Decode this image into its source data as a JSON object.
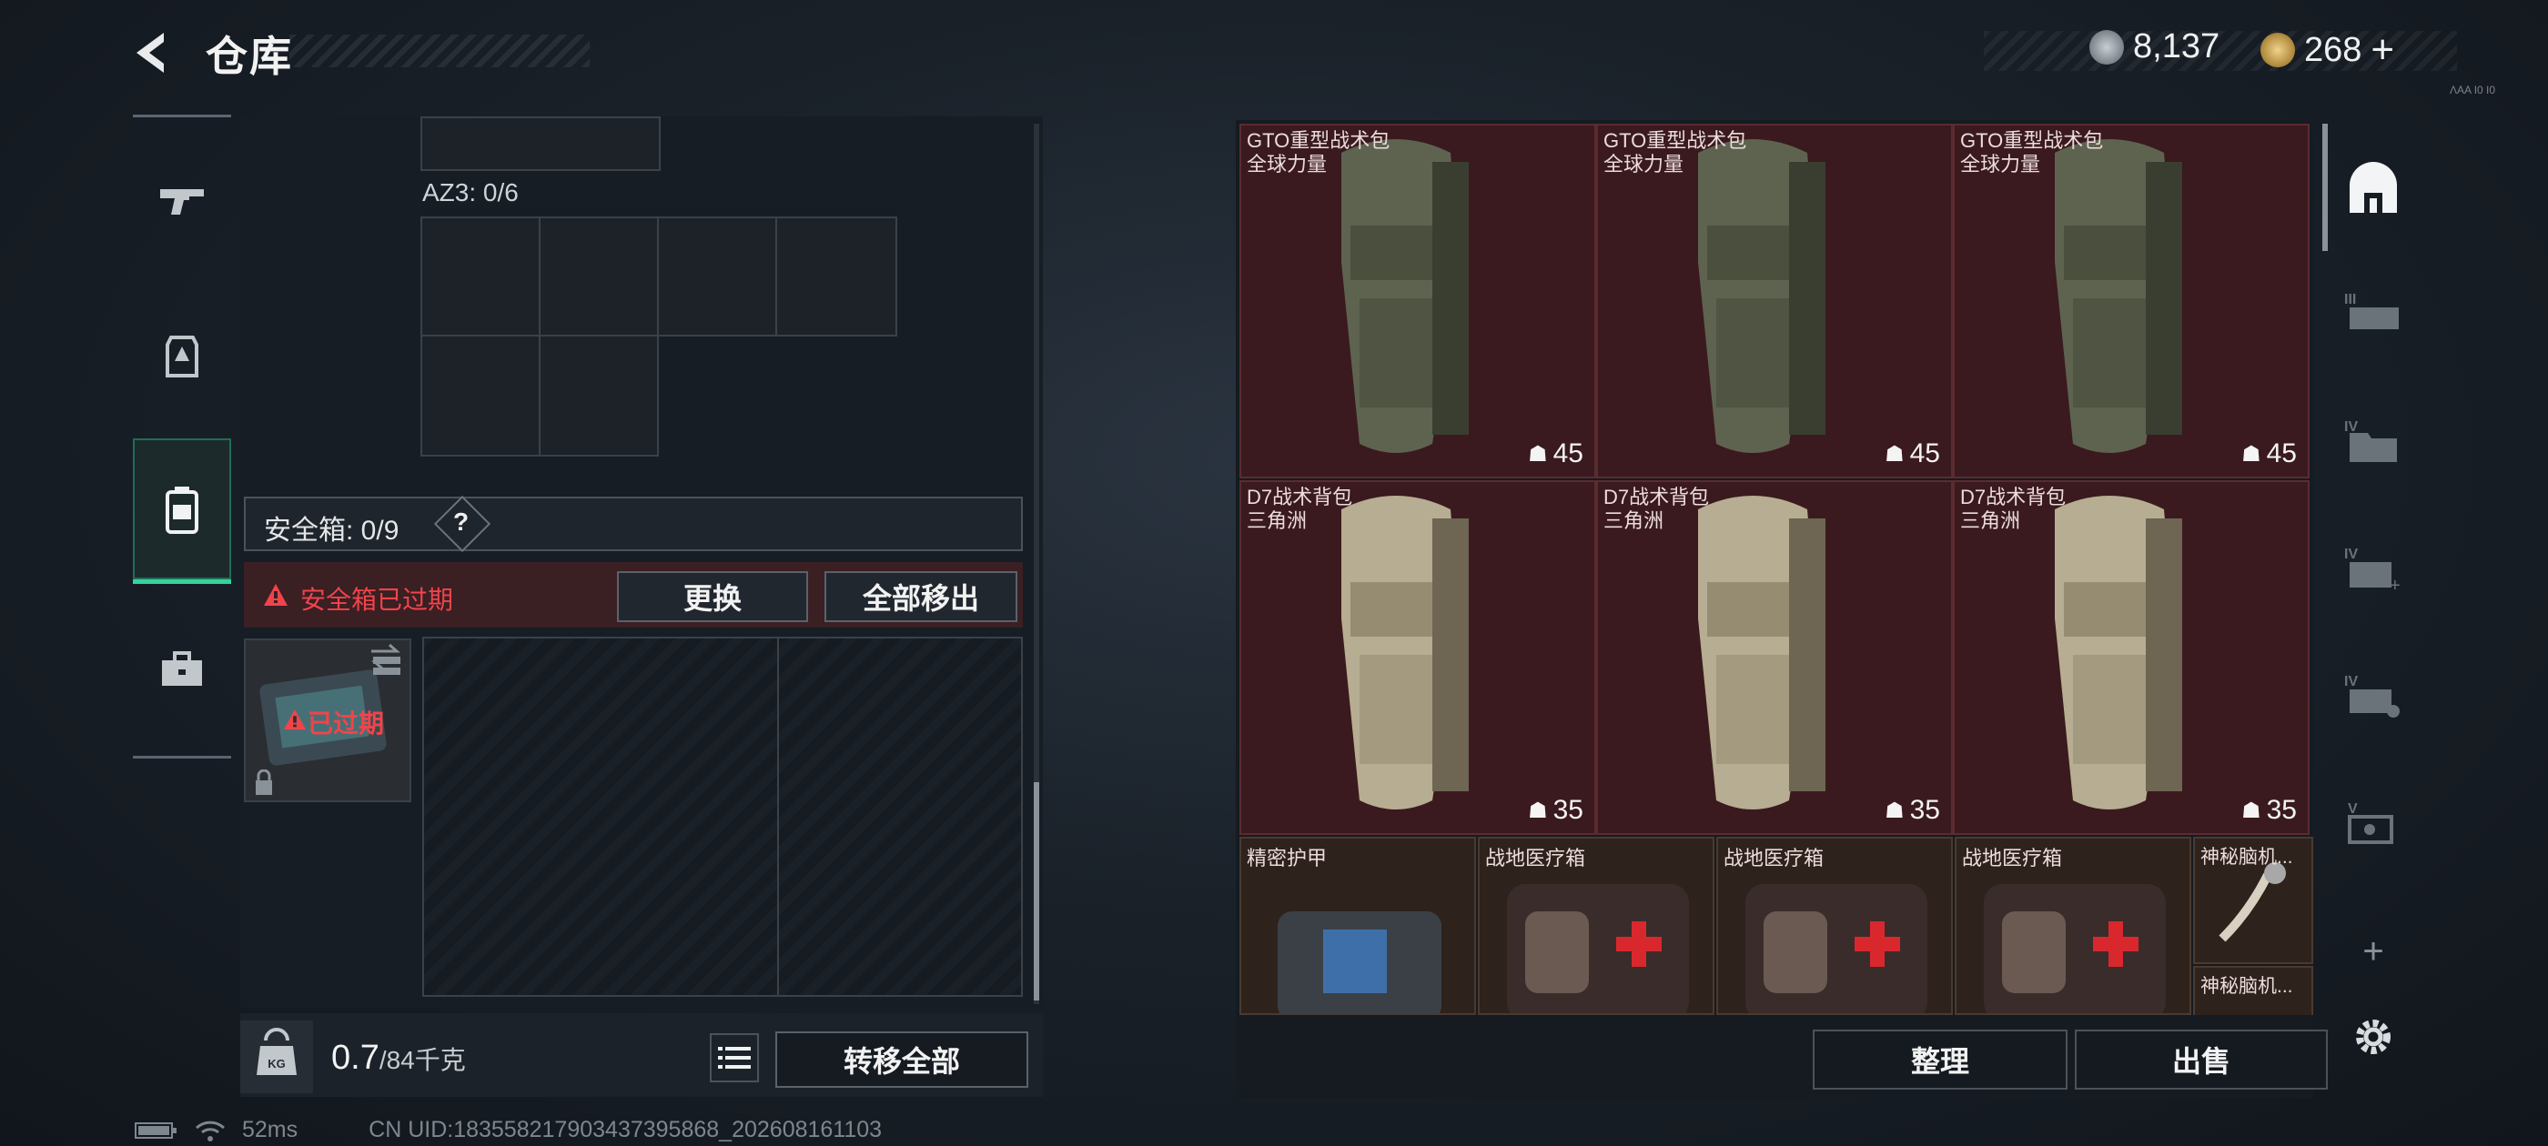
{
  "header": {
    "title": "仓库",
    "currency_1": "8,137",
    "currency_2": "268",
    "currency_plus": "+",
    "version": "ΛΑΑ Ι0 Ι0"
  },
  "left_rail": {
    "items": [
      {
        "icon": "weapon-icon"
      },
      {
        "icon": "armor-vest-icon"
      },
      {
        "icon": "backpack-icon"
      },
      {
        "icon": "toolbox-icon"
      }
    ]
  },
  "left_panel": {
    "az_label": "AZ3: 0/6",
    "safe_label": "安全箱: 0/9",
    "help": "?",
    "warning": "安全箱已过期",
    "replace_button": "更换",
    "move_all_out_button": "全部移出",
    "expired_badge": "已过期",
    "weight_current": "0.7",
    "weight_max": "/84千克",
    "transfer_all_button": "转移全部"
  },
  "status": {
    "ping": "52ms",
    "uid": "CN UID:183558217903437395868_202608161103"
  },
  "items": [
    {
      "name": "GTO重型战术包",
      "sub": "全球力量",
      "count": "45"
    },
    {
      "name": "GTO重型战术包",
      "sub": "全球力量",
      "count": "45"
    },
    {
      "name": "GTO重型战术包",
      "sub": "全球力量",
      "count": "45"
    },
    {
      "name": "D7战术背包",
      "sub": "三角洲",
      "count": "35"
    },
    {
      "name": "D7战术背包",
      "sub": "三角洲",
      "count": "35"
    },
    {
      "name": "D7战术背包",
      "sub": "三角洲",
      "count": "35"
    }
  ],
  "small_items": [
    {
      "name": "精密护甲"
    },
    {
      "name": "战地医疗箱"
    },
    {
      "name": "战地医疗箱"
    },
    {
      "name": "战地医疗箱"
    },
    {
      "name": "神秘脑机...",
      "name2": "神秘脑机..."
    }
  ],
  "right_panel": {
    "sort_button": "整理",
    "sell_button": "出售",
    "side_tabs": [
      "III",
      "IV",
      "IV",
      "IV",
      "V"
    ],
    "add": "+"
  }
}
